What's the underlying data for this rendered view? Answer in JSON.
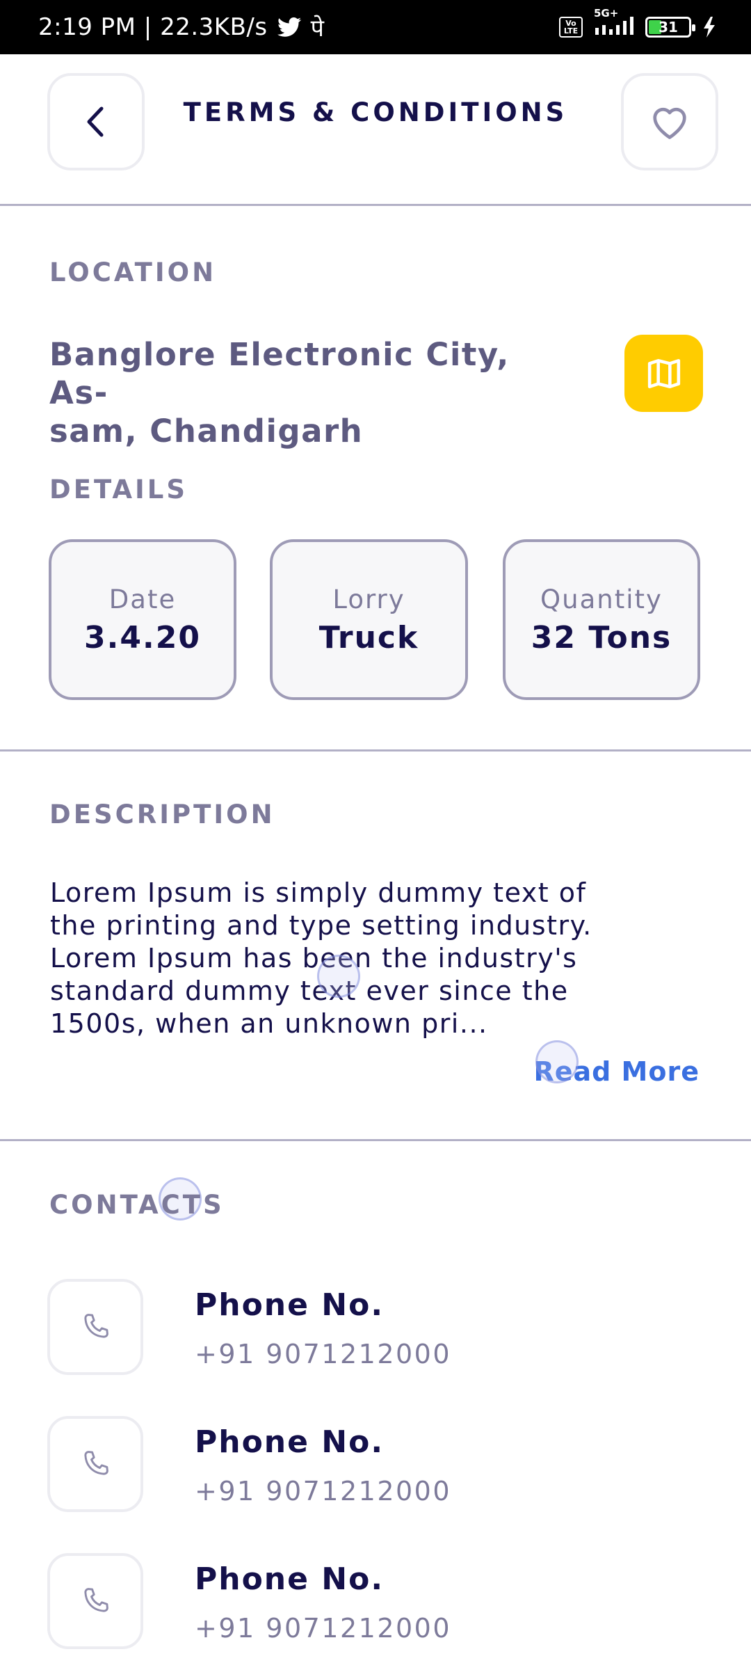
{
  "status_bar": {
    "time_speed": "2:19 PM | 22.3KB/s",
    "extra_glyph": "पे",
    "network": "5G+",
    "volte": "Vo LTE",
    "battery": "31"
  },
  "header": {
    "title": "TERMS & CONDITIONS"
  },
  "location": {
    "label": "LOCATION",
    "line1": "Banglore Electronic City, As-",
    "line2": "sam, Chandigarh"
  },
  "details": {
    "label": "DETAILS",
    "cards": [
      {
        "label": "Date",
        "value": "3.4.20"
      },
      {
        "label": "Lorry",
        "value": "Truck"
      },
      {
        "label": "Quantity",
        "value": "32 Tons"
      }
    ]
  },
  "description": {
    "label": "DESCRIPTION",
    "lines": [
      "Lorem Ipsum is simply dummy text of",
      "the printing and type setting industry.",
      "Lorem Ipsum has been the industry's",
      "standard dummy text ever since the",
      "1500s, when an unknown pri..."
    ],
    "read_more": "Read More"
  },
  "contacts": {
    "label": "CONTACTS",
    "items": [
      {
        "title": "Phone No.",
        "number": "+91 9071212000"
      },
      {
        "title": "Phone No.",
        "number": "+91 9071212000"
      },
      {
        "title": "Phone No.",
        "number": "+91 9071212000"
      }
    ]
  },
  "colors": {
    "accent_yellow": "#ffcc00",
    "link_blue": "#3a6fe0",
    "title_navy": "#14104a",
    "label_gray": "#7d7a9a"
  }
}
